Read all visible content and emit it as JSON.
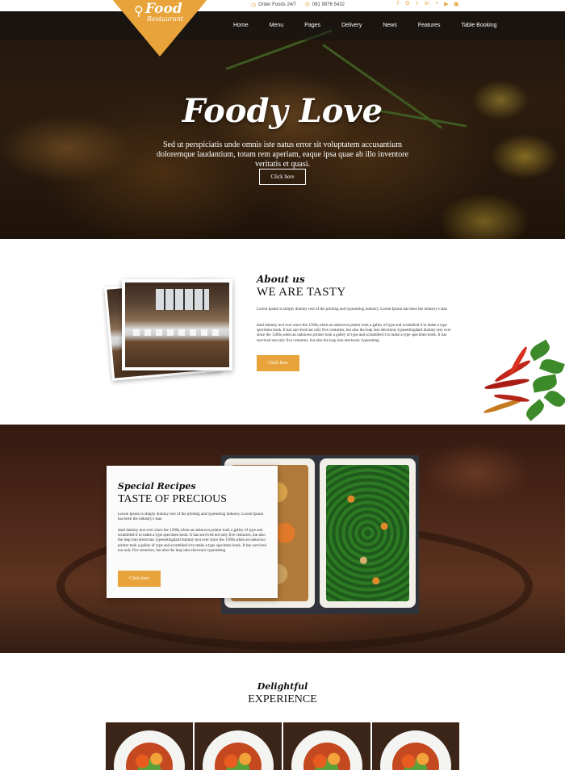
{
  "topbar": {
    "order_text": "Order Foods 24/7",
    "phone": "061 9876 5432",
    "social": [
      {
        "icon": "facebook-icon",
        "glyph": "f"
      },
      {
        "icon": "google-plus-icon",
        "glyph": "G"
      },
      {
        "icon": "twitter-icon",
        "glyph": "t"
      },
      {
        "icon": "linkedin-icon",
        "glyph": "in"
      },
      {
        "icon": "rss-icon",
        "glyph": "•"
      },
      {
        "icon": "youtube-icon",
        "glyph": "▶"
      },
      {
        "icon": "instagram-icon",
        "glyph": "▣"
      }
    ]
  },
  "logo": {
    "line1": "Food",
    "line2": "Restaurant"
  },
  "nav": [
    "Home",
    "Menu",
    "Pages",
    "Delivery",
    "News",
    "Features",
    "Table Booking"
  ],
  "hero": {
    "title": "Foody Love",
    "subtitle": "Sed ut perspiciatis unde omnis iste natus error sit voluptatem accusantium doloremque laudantium, totam rem aperiam, eaque ipsa quae ab illo inventore veritatis et quasi.",
    "button": "Click here"
  },
  "about": {
    "script": "About us",
    "heading": "WE ARE TASTY",
    "para1": "Lorem Ipsum is simply dummy text of the printing and typesetting industry. Lorem Ipsum has been the industry's stan",
    "para2": "dard dummy text ever since the 1500s,when an unknown printer took a galley of type and scrambled it to make a type specimen book. It has survived not only five centuries, but also the leap into electronic typesettingdard dummy text ever since the 1500s,when an unknown printer took a galley of type and scrambled it to make a type specimen book. It has survived not only five centuries, but also the leap into electronic typesetting",
    "button": "Click here"
  },
  "recipes": {
    "script": "Special Recipes",
    "heading": "TASTE OF PRECIOUS",
    "para1": "Lorem Ipsum is simply dummy text of the printing and typesetting industry. Lorem Ipsum has been the industry's stan",
    "para2": "dard dummy text ever since the 1500s,when an unknown printer took a galley of type and scrambled it to make a type specimen book. It has survived not only five centuries, but also the leap into electronic typesettingdard dummy text ever since the 1500s,when an unknown printer took a galley of type and scrambled it to make a type specimen book. It has survived not only five centuries, but also the leap into electronic typesetting",
    "button": "Click here"
  },
  "experience": {
    "script": "Delightful",
    "heading": "EXPERIENCE"
  },
  "colors": {
    "accent": "#e8a33a",
    "nav_overlay": "rgba(20,20,20,0.55)"
  }
}
